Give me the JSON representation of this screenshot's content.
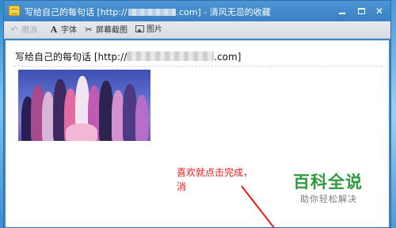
{
  "window": {
    "title_prefix": "写给自己的每句话 [http://",
    "title_suffix": ".com] - 清风无忌的收藏",
    "minimize_glyph": "—",
    "maximize_glyph": "□",
    "close_glyph": "✕"
  },
  "toolbar": {
    "undo_label": "撤消",
    "font_label": "字体",
    "screenshot_label": "屏幕截图",
    "image_label": "图片"
  },
  "note": {
    "title_prefix": "写给自己的每句话 [http://",
    "title_suffix": ".com]"
  },
  "annotation": {
    "line1": "喜欢就点击完成，",
    "line2": "消"
  },
  "watermark": {
    "title": "百科全说",
    "subtitle": "助你轻松解决"
  },
  "colors": {
    "titlebar": "#3f86c8",
    "annotation": "#e8191c",
    "watermark_green": "#2f9a3d"
  },
  "icons": [
    "app-note-icon",
    "undo-icon",
    "font-icon",
    "scissors-icon",
    "image-icon"
  ]
}
